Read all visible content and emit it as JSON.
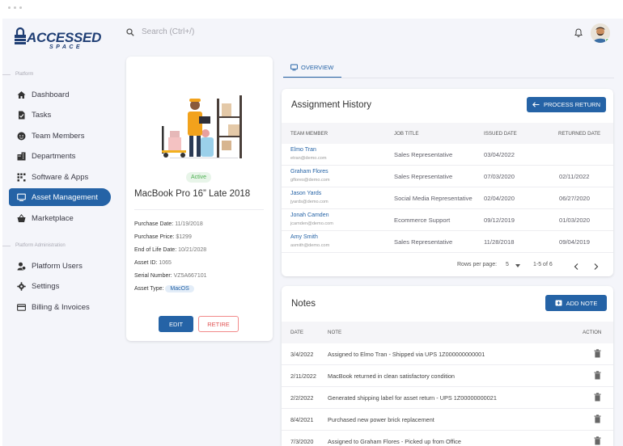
{
  "brand": {
    "name": "ACCESSED",
    "tagline": "SPACE"
  },
  "search": {
    "placeholder": "Search (Ctrl+/)"
  },
  "sidebar": {
    "section_platform": "Platform",
    "section_admin": "Platform Administration",
    "items": [
      {
        "label": "Dashboard",
        "icon": "home-icon"
      },
      {
        "label": "Tasks",
        "icon": "task-icon"
      },
      {
        "label": "Team Members",
        "icon": "face-icon"
      },
      {
        "label": "Departments",
        "icon": "building-icon"
      },
      {
        "label": "Software & Apps",
        "icon": "apps-icon"
      },
      {
        "label": "Asset Management",
        "icon": "monitor-icon",
        "active": true
      },
      {
        "label": "Marketplace",
        "icon": "basket-icon"
      },
      {
        "label": "Platform Users",
        "icon": "users-icon"
      },
      {
        "label": "Settings",
        "icon": "gear-icon"
      },
      {
        "label": "Billing & Invoices",
        "icon": "credit-card-icon"
      }
    ]
  },
  "asset": {
    "status": "Active",
    "title": "MacBook Pro 16” Late 2018",
    "specs": [
      {
        "label": "Purchase Date:",
        "value": "11/19/2018"
      },
      {
        "label": "Purchase Price:",
        "value": "$1299"
      },
      {
        "label": "End of Life Date:",
        "value": "10/21/2028"
      },
      {
        "label": "Asset ID:",
        "value": "1065"
      },
      {
        "label": "Serial Number:",
        "value": "VZ5A667101"
      },
      {
        "label": "Asset Type:",
        "value": "MacOS"
      }
    ],
    "edit_label": "EDIT",
    "retire_label": "RETIRE"
  },
  "tabs": {
    "overview": "OVERVIEW"
  },
  "assignment": {
    "title": "Assignment History",
    "process_label": "PROCESS RETURN",
    "columns": [
      "TEAM MEMBER",
      "JOB TITLE",
      "ISSUED DATE",
      "RETURNED DATE"
    ],
    "rows": [
      {
        "name": "Elmo Tran",
        "email": "etran@demo.com",
        "job": "Sales Representative",
        "issued": "03/04/2022",
        "returned": ""
      },
      {
        "name": "Graham Flores",
        "email": "gflores@demo.com",
        "job": "Sales Representative",
        "issued": "07/03/2020",
        "returned": "02/11/2022"
      },
      {
        "name": "Jason Yards",
        "email": "jyards@demo.com",
        "job": "Social Media Representative",
        "issued": "02/04/2020",
        "returned": "06/27/2020"
      },
      {
        "name": "Jonah Camden",
        "email": "jcamden@demo.com",
        "job": "Ecommerce Support",
        "issued": "09/12/2019",
        "returned": "01/03/2020"
      },
      {
        "name": "Amy Smith",
        "email": "asmith@demo.com",
        "job": "Sales Representative",
        "issued": "11/28/2018",
        "returned": "09/04/2019"
      }
    ],
    "rows_per_page_label": "Rows per page:",
    "rows_per_page": "5",
    "range": "1-5 of 6"
  },
  "notes": {
    "title": "Notes",
    "add_label": "ADD NOTE",
    "columns": [
      "DATE",
      "NOTE",
      "ACTION"
    ],
    "rows": [
      {
        "date": "3/4/2022",
        "note": "Assigned to Elmo Tran - Shipped via UPS 1Z000000000001"
      },
      {
        "date": "2/11/2022",
        "note": "MacBook returned in clean satisfactory condition"
      },
      {
        "date": "2/2/2022",
        "note": "Generated shipping label for asset return - UPS 1Z00000000021"
      },
      {
        "date": "8/4/2021",
        "note": "Purchased new power brick replacement"
      },
      {
        "date": "7/3/2020",
        "note": "Assigned to Graham Flores - Picked up from Office"
      }
    ]
  },
  "colors": {
    "primary": "#2563a6",
    "success": "#4caf50",
    "danger": "#e05353"
  }
}
